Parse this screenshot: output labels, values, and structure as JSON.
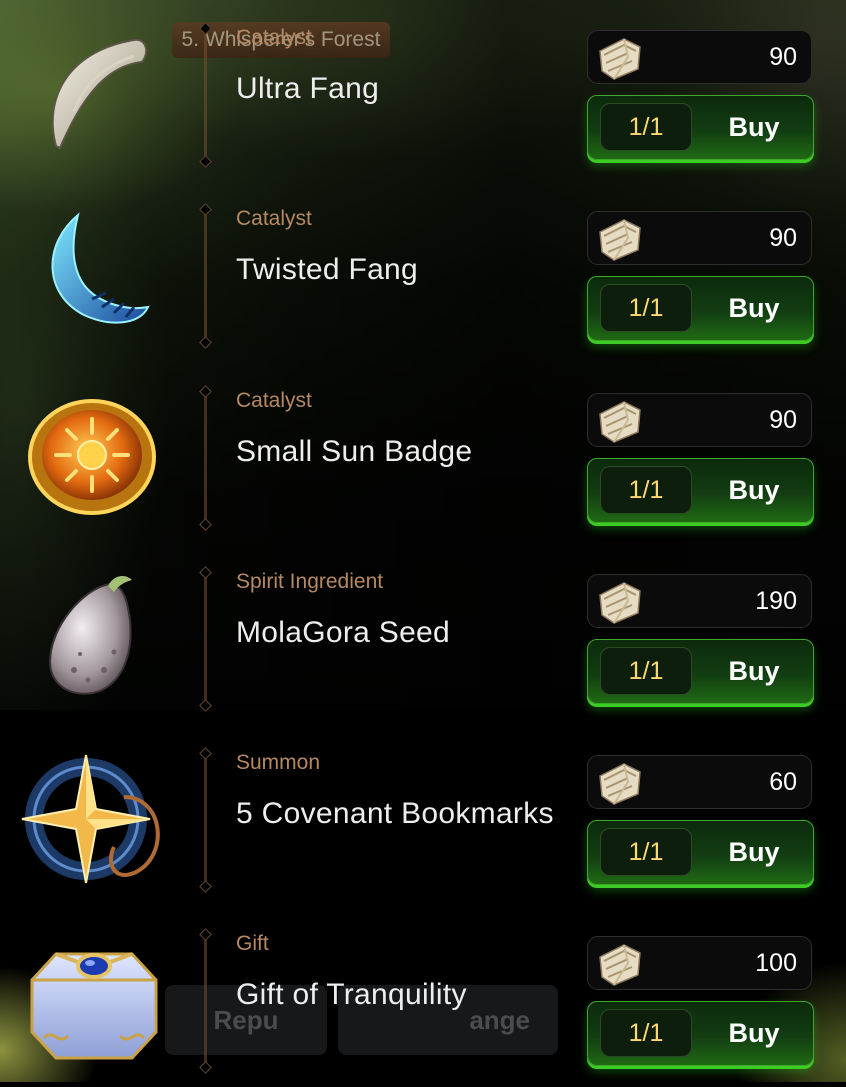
{
  "header": {
    "location": "5. Whisperer's Forest"
  },
  "currency_icon": "cloth-scroll-icon",
  "background_buttons": [
    {
      "label": "Repu"
    },
    {
      "label": "ange"
    }
  ],
  "shop": {
    "items": [
      {
        "category": "Catalyst",
        "name": "Ultra Fang",
        "price": "90",
        "limit": "1/1",
        "buy_label": "Buy",
        "icon": "ultra-fang-icon"
      },
      {
        "category": "Catalyst",
        "name": "Twisted Fang",
        "price": "90",
        "limit": "1/1",
        "buy_label": "Buy",
        "icon": "twisted-fang-icon"
      },
      {
        "category": "Catalyst",
        "name": "Small Sun Badge",
        "price": "90",
        "limit": "1/1",
        "buy_label": "Buy",
        "icon": "sun-badge-icon"
      },
      {
        "category": "Spirit Ingredient",
        "name": "MolaGora Seed",
        "price": "190",
        "limit": "1/1",
        "buy_label": "Buy",
        "icon": "molagora-seed-icon"
      },
      {
        "category": "Summon",
        "name": "5 Covenant Bookmarks",
        "price": "60",
        "limit": "1/1",
        "buy_label": "Buy",
        "icon": "covenant-bookmark-icon"
      },
      {
        "category": "Gift",
        "name": "Gift of Tranquility",
        "price": "100",
        "limit": "1/1",
        "buy_label": "Buy",
        "icon": "gift-box-icon"
      }
    ]
  }
}
